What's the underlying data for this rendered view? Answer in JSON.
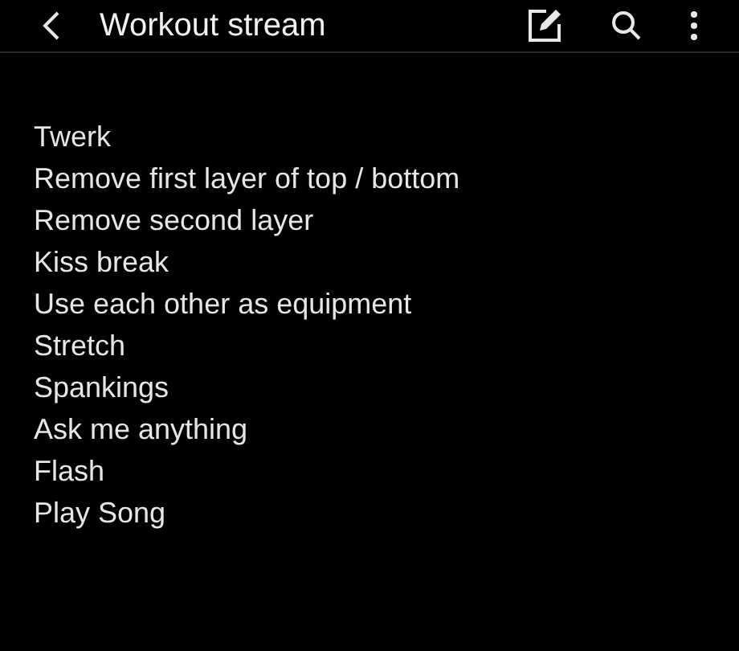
{
  "header": {
    "title": "Workout stream"
  },
  "note_lines": [
    "Twerk",
    "Remove first layer of top / bottom",
    "Remove second layer",
    "Kiss break",
    "Use each other as equipment",
    "Stretch",
    "Spankings",
    "Ask me anything",
    "Flash",
    "Play Song"
  ]
}
